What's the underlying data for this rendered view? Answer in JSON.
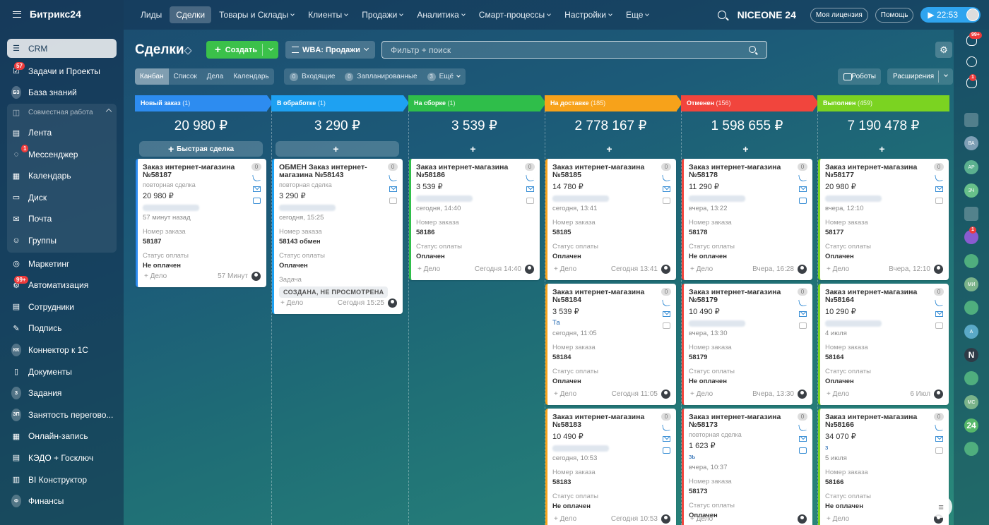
{
  "sidebar": {
    "logo": "Битрикс24",
    "items": [
      {
        "label": "CRM",
        "icon": "filter-icon"
      },
      {
        "label": "Задачи и Проекты",
        "icon": "tasks-icon",
        "badge": "57"
      },
      {
        "label": "База знаний",
        "icon": "kb-icon",
        "abbr": "БЗ"
      }
    ],
    "group": {
      "label": "Совместная работа",
      "items": [
        {
          "label": "Лента",
          "icon": "feed-icon"
        },
        {
          "label": "Мессенджер",
          "icon": "messenger-icon",
          "badge": "1"
        },
        {
          "label": "Календарь",
          "icon": "calendar-icon"
        },
        {
          "label": "Диск",
          "icon": "disk-icon"
        },
        {
          "label": "Почта",
          "icon": "mail-icon"
        },
        {
          "label": "Группы",
          "icon": "groups-icon"
        }
      ]
    },
    "items2": [
      {
        "label": "Маркетинг",
        "icon": "marketing-icon"
      },
      {
        "label": "Автоматизация",
        "icon": "automation-icon",
        "badge": "99+"
      },
      {
        "label": "Сотрудники",
        "icon": "employees-icon"
      },
      {
        "label": "Подпись",
        "icon": "sign-icon"
      },
      {
        "label": "Коннектор к 1С",
        "icon": "connector-icon",
        "abbr": "КК"
      },
      {
        "label": "Документы",
        "icon": "documents-icon"
      },
      {
        "label": "Задания",
        "icon": "assignments-icon",
        "abbr": "З"
      },
      {
        "label": "Занятость перегово...",
        "icon": "rooms-icon",
        "abbr": "ЗП"
      },
      {
        "label": "Онлайн-запись",
        "icon": "booking-icon"
      },
      {
        "label": "КЭДО + Госключ",
        "icon": "kedo-icon"
      },
      {
        "label": "BI Конструктор",
        "icon": "bi-icon"
      },
      {
        "label": "Финансы",
        "icon": "finance-icon",
        "abbr": "Ф"
      }
    ]
  },
  "topbar": {
    "nav": [
      {
        "label": "Лиды",
        "dd": false
      },
      {
        "label": "Сделки",
        "dd": false,
        "active": true
      },
      {
        "label": "Товары и Склады",
        "dd": true
      },
      {
        "label": "Клиенты",
        "dd": true
      },
      {
        "label": "Продажи",
        "dd": true
      },
      {
        "label": "Аналитика",
        "dd": true
      },
      {
        "label": "Смарт-процессы",
        "dd": true
      },
      {
        "label": "Настройки",
        "dd": true
      },
      {
        "label": "Еще",
        "dd": true
      }
    ],
    "brand": "NICEONE 24",
    "license": "Моя лицензия",
    "help": "Помощь",
    "time": "22:53"
  },
  "header": {
    "title": "Сделки",
    "create": "Создать",
    "funnel": "WBA: Продажи",
    "filter_placeholder": "Фильтр + поиск"
  },
  "views": {
    "tabs": [
      "Канбан",
      "Список",
      "Дела",
      "Календарь"
    ],
    "counters": [
      {
        "n": "0",
        "label": "Входящие"
      },
      {
        "n": "0",
        "label": "Запланированные"
      },
      {
        "n": "3",
        "label": "Ещё"
      }
    ],
    "robots": "Роботы",
    "extensions": "Расширения"
  },
  "columns": [
    {
      "name": "Новый заказ",
      "count": "(1)",
      "sum": "20 980 ₽",
      "color": "#2d8cf0",
      "add": "Быстрая сделка",
      "cards": [
        {
          "title": "Заказ интернет-магазина №58187",
          "sub": "повторная сделка",
          "amount": "20 980 ₽",
          "time": "57 минут назад",
          "order_lbl": "Номер заказа",
          "order": "58187",
          "pay_lbl": "Статус оплаты",
          "pay": "Не оплачен",
          "foot": "57 Минут",
          "delo": "+ Дело",
          "cnt": "0",
          "chat": true
        }
      ]
    },
    {
      "name": "В обработке",
      "count": "(1)",
      "sum": "3 290 ₽",
      "color": "#1ea1f2",
      "add": "",
      "cards": [
        {
          "title": "ОБМЕН Заказ интернет-магазина №58143",
          "sub": "повторная сделка",
          "amount": "3 290 ₽",
          "time": "сегодня, 15:25",
          "order_lbl": "Номер заказа",
          "order": "58143 обмен",
          "pay_lbl": "Статус оплаты",
          "pay": "Оплачен",
          "task_lbl": "Задача",
          "task": "СОЗДАНА, НЕ ПРОСМОТРЕНА",
          "foot": "Сегодня 15:25",
          "delo": "+ Дело",
          "cnt": "0",
          "chat": false
        }
      ]
    },
    {
      "name": "На сборке",
      "count": "(1)",
      "sum": "3 539 ₽",
      "color": "#2fbe4a",
      "add": "",
      "cards": [
        {
          "title": "Заказ интернет-магазина №58186",
          "sub": "",
          "amount": "3 539 ₽",
          "time": "сегодня, 14:40",
          "order_lbl": "Номер заказа",
          "order": "58186",
          "pay_lbl": "Статус оплаты",
          "pay": "Оплачен",
          "foot": "Сегодня 14:40",
          "delo": "+ Дело",
          "cnt": "0",
          "chat": false
        }
      ]
    },
    {
      "name": "На доставке",
      "count": "(185)",
      "sum": "2 778 167 ₽",
      "color": "#f7a21a",
      "add": "",
      "cards": [
        {
          "title": "Заказ интернет-магазина №58185",
          "sub": "",
          "amount": "14 780 ₽",
          "time": "сегодня, 13:41",
          "order_lbl": "Номер заказа",
          "order": "58185",
          "pay_lbl": "Статус оплаты",
          "pay": "Оплачен",
          "foot": "Сегодня 13:41",
          "delo": "+ Дело",
          "cnt": "0",
          "chat": false
        },
        {
          "title": "Заказ интернет-магазина №58184",
          "sub": "",
          "amount": "3 539 ₽",
          "client": "Та",
          "time": "сегодня, 11:05",
          "order_lbl": "Номер заказа",
          "order": "58184",
          "pay_lbl": "Статус оплаты",
          "pay": "Оплачен",
          "foot": "Сегодня 11:05",
          "delo": "+ Дело",
          "cnt": "0",
          "chat": false
        },
        {
          "title": "Заказ интернет-магазина №58183",
          "sub": "",
          "amount": "10 490 ₽",
          "time": "сегодня, 10:53",
          "order_lbl": "Номер заказа",
          "order": "58183",
          "pay_lbl": "Статус оплаты",
          "pay": "Не оплачен",
          "foot": "Сегодня 10:53",
          "delo": "+ Дело",
          "cnt": "0",
          "chat": true
        }
      ]
    },
    {
      "name": "Отменен",
      "count": "(156)",
      "sum": "1 598 655 ₽",
      "color": "#f1453d",
      "add": "",
      "cards": [
        {
          "title": "Заказ интернет-магазина №58178",
          "sub": "",
          "amount": "11 290 ₽",
          "time": "вчера, 13:22",
          "order_lbl": "Номер заказа",
          "order": "58178",
          "pay_lbl": "Статус оплаты",
          "pay": "Не оплачен",
          "foot": "Вчера, 16:28",
          "delo": "+ Дело",
          "cnt": "0",
          "chat": true
        },
        {
          "title": "Заказ интернет-магазина №58179",
          "sub": "",
          "amount": "10 490 ₽",
          "time": "вчера, 13:30",
          "order_lbl": "Номер заказа",
          "order": "58179",
          "pay_lbl": "Статус оплаты",
          "pay": "Не оплачен",
          "foot": "Вчера, 13:30",
          "delo": "+ Дело",
          "cnt": "0",
          "chat": false
        },
        {
          "title": "Заказ интернет-магазина №58173",
          "sub": "повторная сделка",
          "amount": "1 623 ₽",
          "client": "зь",
          "time": "вчера, 10:37",
          "order_lbl": "Номер заказа",
          "order": "58173",
          "pay_lbl": "Статус оплаты",
          "pay": "Оплачен",
          "foot": "",
          "delo": "+ Дело",
          "cnt": "0",
          "chat": true
        }
      ]
    },
    {
      "name": "Выполнен",
      "count": "(459)",
      "sum": "7 190 478 ₽",
      "color": "#7bd321",
      "add": "",
      "cards": [
        {
          "title": "Заказ интернет-магазина №58177",
          "sub": "",
          "amount": "20 980 ₽",
          "time": "вчера, 12:10",
          "order_lbl": "Номер заказа",
          "order": "58177",
          "pay_lbl": "Статус оплаты",
          "pay": "Оплачен",
          "foot": "Вчера, 12:10",
          "delo": "+ Дело",
          "cnt": "0",
          "chat": false
        },
        {
          "title": "Заказ интернет-магазина №58164",
          "sub": "",
          "amount": "10 290 ₽",
          "time": "4 июля",
          "order_lbl": "Номер заказа",
          "order": "58164",
          "pay_lbl": "Статус оплаты",
          "pay": "Оплачен",
          "foot": "6 Июл",
          "delo": "+ Дело",
          "cnt": "0",
          "chat": false
        },
        {
          "title": "Заказ интернет-магазина №58166",
          "sub": "",
          "amount": "34 070 ₽",
          "client": "з",
          "time": "5 июля",
          "order_lbl": "Номер заказа",
          "order": "58166",
          "pay_lbl": "Статус оплаты",
          "pay": "Не оплачен",
          "foot": "",
          "delo": "+ Дело",
          "cnt": "0",
          "chat": false
        }
      ]
    }
  ],
  "rightbar": {
    "items": [
      {
        "icon": "bell-icon",
        "badge": "99+"
      },
      {
        "icon": "pulse-icon"
      },
      {
        "icon": "chat-icon",
        "badge": "1"
      },
      {
        "icon": "video-icon"
      },
      {
        "icon": "avatar-ba",
        "label": "ВА"
      },
      {
        "icon": "avatar-ar",
        "label": "АР"
      },
      {
        "icon": "avatar-zch",
        "label": "ЗЧ"
      },
      {
        "icon": "video2-icon"
      },
      {
        "icon": "group-chat-icon",
        "badge": "1"
      },
      {
        "icon": "contact-icon"
      },
      {
        "icon": "avatar-mi",
        "label": "МИ"
      },
      {
        "icon": "contact2-icon"
      },
      {
        "icon": "avatar-a",
        "label": "А"
      },
      {
        "icon": "avatar-n",
        "label": "N"
      },
      {
        "icon": "contact3-icon"
      },
      {
        "icon": "avatar-mc",
        "label": "МС"
      },
      {
        "icon": "b24-icon",
        "label": "24"
      },
      {
        "icon": "contact4-icon"
      }
    ]
  },
  "colors": {
    "create": "#3bc14a",
    "accent": "#2fa4ef",
    "badge": "#ee3b3b"
  }
}
